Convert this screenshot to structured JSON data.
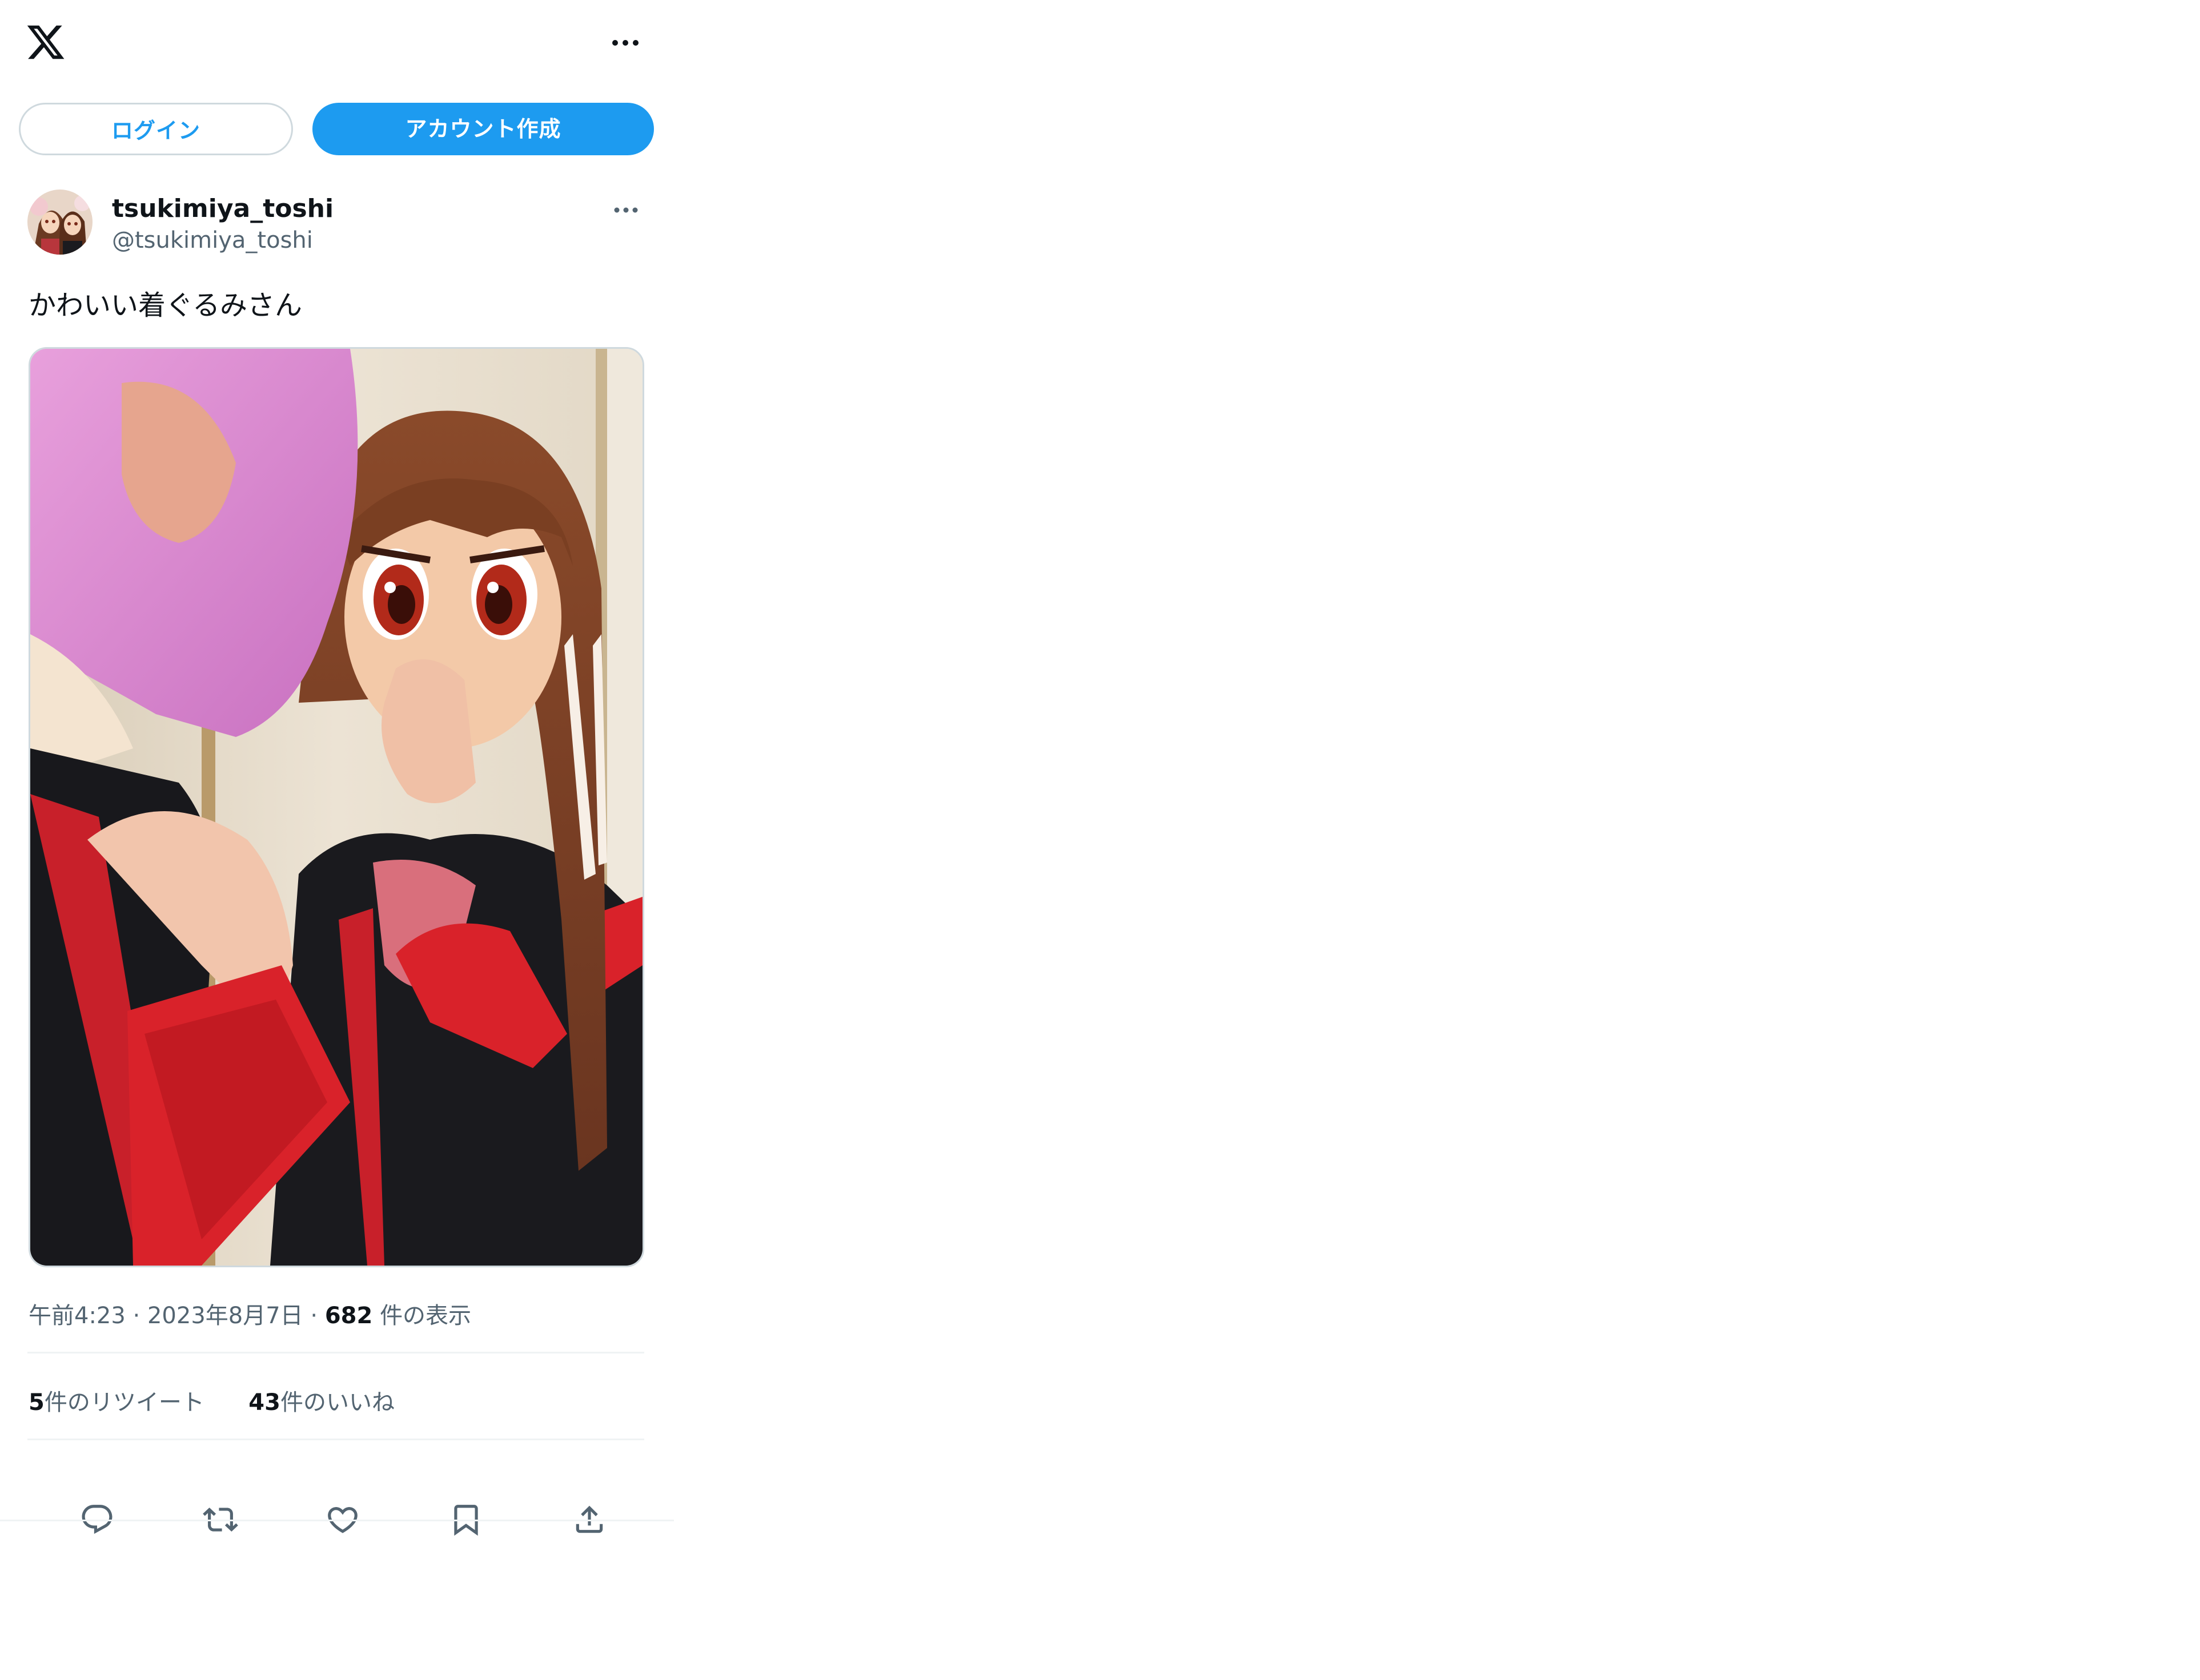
{
  "header": {
    "logo_icon": "x-logo-icon",
    "more_icon": "more-horizontal-icon"
  },
  "auth": {
    "login_label": "ログイン",
    "signup_label": "アカウント作成",
    "accent_color": "#1d9bf0"
  },
  "tweet": {
    "display_name": "tsukimiya_toshi",
    "handle": "@tsukimiya_toshi",
    "text": "かわいい着ぐるみさん",
    "media_icon": "photo-kigurumi-cosplay",
    "time": "午前4:23",
    "date": "2023年8月7日",
    "views_count": "682",
    "views_label": "件の表示",
    "retweets_count": "5",
    "retweets_label": "件のリツイート",
    "likes_count": "43",
    "likes_label": "件のいいね"
  },
  "actions": {
    "reply_icon": "reply-icon",
    "retweet_icon": "retweet-icon",
    "like_icon": "heart-icon",
    "bookmark_icon": "bookmark-icon",
    "share_icon": "share-icon"
  }
}
